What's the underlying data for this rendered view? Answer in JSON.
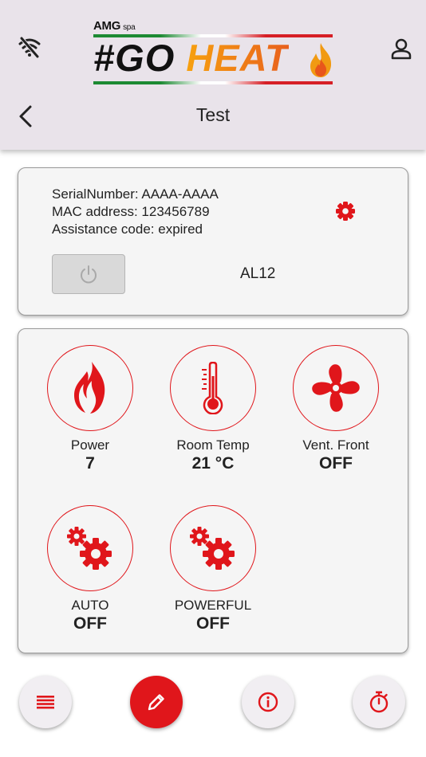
{
  "header": {
    "logo_company": "AMG",
    "logo_company_suffix": "spa",
    "logo_word_go": "#GO",
    "logo_word_heat": "HEAT",
    "title": "Test"
  },
  "device": {
    "serial": "SerialNumber: AAAA-AAAA",
    "mac": "MAC address: 123456789",
    "assistance": "Assistance code: expired",
    "model": "AL12"
  },
  "tiles": [
    {
      "label": "Power",
      "value": "7",
      "icon": "flame-icon"
    },
    {
      "label": "Room Temp",
      "value": "21 °C",
      "icon": "thermometer-icon"
    },
    {
      "label": "Vent. Front",
      "value": "OFF",
      "icon": "fan-icon"
    },
    {
      "label": "AUTO",
      "value": "OFF",
      "icon": "gears-icon"
    },
    {
      "label": "POWERFUL",
      "value": "OFF",
      "icon": "gears-icon"
    }
  ],
  "bottom_nav": [
    "list-icon",
    "pencil-icon",
    "info-icon",
    "timer-icon"
  ],
  "colors": {
    "accent": "#e0161b",
    "header_bg": "#e9e3ea",
    "card_bg": "#f5f5f5"
  }
}
